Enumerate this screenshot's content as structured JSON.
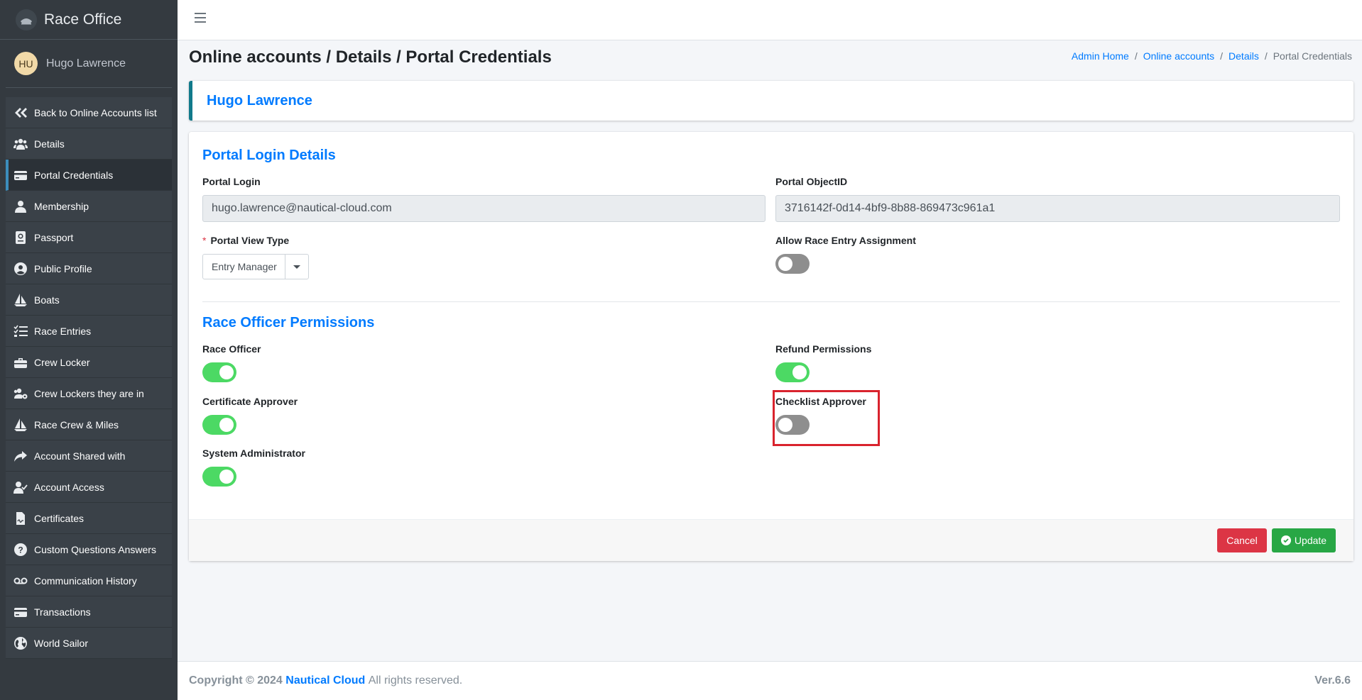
{
  "sidebar": {
    "brand": "Race Office",
    "user": {
      "initials": "HU",
      "name": "Hugo Lawrence"
    },
    "items": [
      {
        "label": "Back to Online Accounts list",
        "icon": "double-chevron-left-icon"
      },
      {
        "label": "Details",
        "icon": "users-icon"
      },
      {
        "label": "Portal Credentials",
        "icon": "credit-card-icon",
        "active": true
      },
      {
        "label": "Membership",
        "icon": "user-icon"
      },
      {
        "label": "Passport",
        "icon": "passport-icon"
      },
      {
        "label": "Public Profile",
        "icon": "user-circle-icon"
      },
      {
        "label": "Boats",
        "icon": "sailboat-icon"
      },
      {
        "label": "Race Entries",
        "icon": "tasks-icon"
      },
      {
        "label": "Crew Locker",
        "icon": "toolbox-icon"
      },
      {
        "label": "Crew Lockers they are in",
        "icon": "users-cog-icon"
      },
      {
        "label": "Race Crew & Miles",
        "icon": "sailboat-icon"
      },
      {
        "label": "Account Shared with",
        "icon": "share-icon"
      },
      {
        "label": "Account Access",
        "icon": "user-check-icon"
      },
      {
        "label": "Certificates",
        "icon": "file-signature-icon"
      },
      {
        "label": "Custom Questions Answers",
        "icon": "question-circle-icon"
      },
      {
        "label": "Communication History",
        "icon": "voicemail-icon"
      },
      {
        "label": "Transactions",
        "icon": "credit-card-icon"
      },
      {
        "label": "World Sailor",
        "icon": "globe-icon"
      }
    ]
  },
  "header": {
    "title": "Online accounts / Details / Portal Credentials",
    "breadcrumb": {
      "home": "Admin Home",
      "accounts": "Online accounts",
      "details": "Details",
      "current": "Portal Credentials",
      "separator": "/"
    }
  },
  "account": {
    "name": "Hugo Lawrence"
  },
  "portal": {
    "section_title": "Portal Login Details",
    "login_label": "Portal Login",
    "login_value": "hugo.lawrence@nautical-cloud.com",
    "objectid_label": "Portal ObjectID",
    "objectid_value": "3716142f-0d14-4bf9-8b88-869473c961a1",
    "view_type_label": "Portal View Type",
    "required_mark": "*",
    "view_type_value": "Entry Manager",
    "race_entry_label": "Allow Race Entry Assignment",
    "race_entry_on": false
  },
  "permissions": {
    "section_title": "Race Officer Permissions",
    "race_officer": {
      "label": "Race Officer",
      "on": true
    },
    "refund": {
      "label": "Refund Permissions",
      "on": true
    },
    "certificate_approver": {
      "label": "Certificate Approver",
      "on": true
    },
    "checklist_approver": {
      "label": "Checklist Approver",
      "on": false
    },
    "system_admin": {
      "label": "System Administrator",
      "on": true
    }
  },
  "actions": {
    "cancel": "Cancel",
    "update": "Update"
  },
  "footer": {
    "copyright": "Copyright © 2024",
    "company": "Nautical Cloud",
    "rights": "All rights reserved.",
    "version": "Ver.6.6"
  },
  "colors": {
    "sidebar_bg": "#343a40",
    "link": "#007bff",
    "toggle_on": "#4cd964",
    "toggle_off": "#8e8e8e",
    "cancel": "#dc3545",
    "update": "#28a745",
    "highlight": "#d9232d"
  }
}
